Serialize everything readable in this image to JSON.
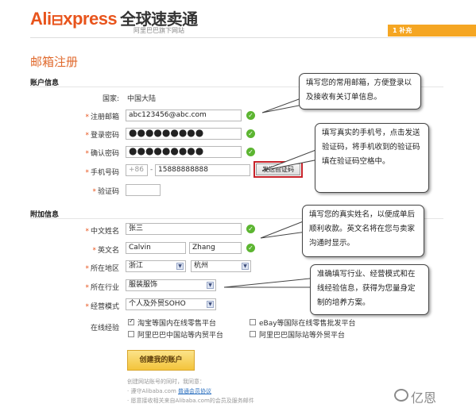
{
  "header": {
    "logo_ali": "Ali",
    "logo_xpress": "xpress",
    "logo_cn": "全球速卖通",
    "tagline": "阿里巴巴旗下网站",
    "steps_label": "1 补充"
  },
  "page": {
    "title": "邮箱注册"
  },
  "account_section": {
    "heading": "账户信息",
    "country_label": "国家:",
    "country_value": "中国大陆",
    "email_label": "注册邮箱",
    "email_value": "abc123456@abc.com",
    "password_label": "登录密码",
    "password_value": "●●●●●●●●●",
    "confirm_label": "确认密码",
    "confirm_value": "●●●●●●●●●",
    "phone_label": "手机号码",
    "phone_prefix": "+86",
    "phone_dash": "-",
    "phone_value": "15888888888",
    "send_code_button": "发送验证码",
    "verify_label": "验证码",
    "verify_value": ""
  },
  "extra_section": {
    "heading": "附加信息",
    "cn_name_label": "中文姓名",
    "cn_name_value": "张三",
    "en_name_label": "英文名",
    "first_name": "Calvin",
    "last_name": "Zhang",
    "region_label": "所在地区",
    "province": "浙江",
    "city": "杭州",
    "industry_label": "所在行业",
    "industry": "服装服饰",
    "mode_label": "经营模式",
    "mode": "个人及外贸SOHO",
    "experience_label": "在线经验",
    "experience_options": [
      {
        "label": "淘宝等国内在线零售平台",
        "checked": true
      },
      {
        "label": "eBay等国际在线零售批发平台",
        "checked": false
      },
      {
        "label": "阿里巴巴中国站等内贸平台",
        "checked": false
      },
      {
        "label": "阿里巴巴国际站等外贸平台",
        "checked": false
      }
    ]
  },
  "create_button": "创建我的账户",
  "footer": {
    "line1": "创建网站账号的同时，我同意：",
    "line2_prefix": "· 遵守Alibaba.com",
    "line2_link": "普通会员协议",
    "line3": "· 愿意接收相关来自Alibaba.com的会员及服务邮件"
  },
  "bubbles": {
    "email_tip": "填写您的常用邮箱，方便登录以及接收有关订单信息。",
    "phone_tip": "填写真实的手机号，点击发送验证码，将手机收到的验证码填在验证码空格中。",
    "name_tip": "填写您的真实姓名，以便成单后顺利收款。英文名将在您与卖家沟通时显示。",
    "industry_tip": "准确填写行业、经营模式和在线经验信息，获得为您量身定制的培养方案。"
  },
  "watermark": "亿恩",
  "colors": {
    "accent": "#e8541c",
    "ok_green": "#5cb531",
    "highlight_red": "#c8232a",
    "button_yellow": "#f3c43b"
  }
}
